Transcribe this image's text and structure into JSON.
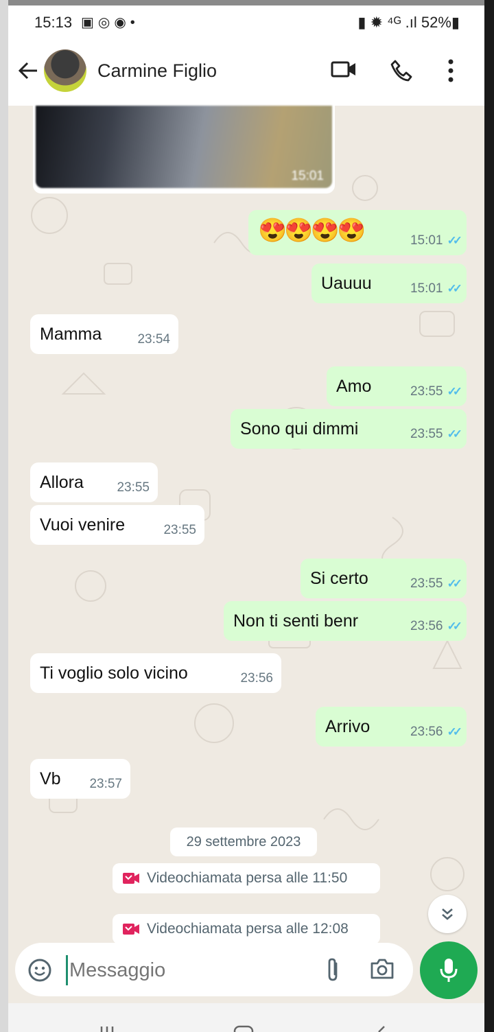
{
  "status_bar": {
    "time": "15:13",
    "battery": "52%"
  },
  "header": {
    "contact_name": "Carmine Figlio"
  },
  "media": {
    "time": "15:01"
  },
  "messages": [
    {
      "dir": "out",
      "text": "😍😍😍😍",
      "time": "15:01"
    },
    {
      "dir": "out",
      "text": "Uauuu",
      "time": "15:01"
    },
    {
      "dir": "in",
      "text": "Mamma",
      "time": "23:54"
    },
    {
      "dir": "out",
      "text": "Amo",
      "time": "23:55"
    },
    {
      "dir": "out",
      "text": "Sono qui dimmi",
      "time": "23:55"
    },
    {
      "dir": "in",
      "text": "Allora",
      "time": "23:55"
    },
    {
      "dir": "in",
      "text": "Vuoi venire",
      "time": "23:55"
    },
    {
      "dir": "out",
      "text": "Si certo",
      "time": "23:55"
    },
    {
      "dir": "out",
      "text": "Non ti senti benr",
      "time": "23:56"
    },
    {
      "dir": "in",
      "text": "Ti voglio solo vicino",
      "time": "23:56"
    },
    {
      "dir": "out",
      "text": "Arrivo",
      "time": "23:56"
    },
    {
      "dir": "in",
      "text": "Vb",
      "time": "23:57"
    }
  ],
  "date_divider": "29 settembre 2023",
  "missed_calls": [
    {
      "text": "Videochiamata persa alle 11:50"
    },
    {
      "text": "Videochiamata persa alle 12:08"
    }
  ],
  "composer": {
    "placeholder": "Messaggio"
  },
  "colors": {
    "accent": "#1faa53",
    "outgoing_bubble": "#d9fdd3",
    "read_ticks": "#53bdeb",
    "missed_call": "#e0245e"
  },
  "icons": [
    "arrow-back-icon",
    "video-call-icon",
    "phone-icon",
    "more-vert-icon",
    "emoji-icon",
    "attach-icon",
    "camera-icon",
    "mic-icon",
    "double-chevron-down-icon",
    "missed-video-call-icon"
  ]
}
